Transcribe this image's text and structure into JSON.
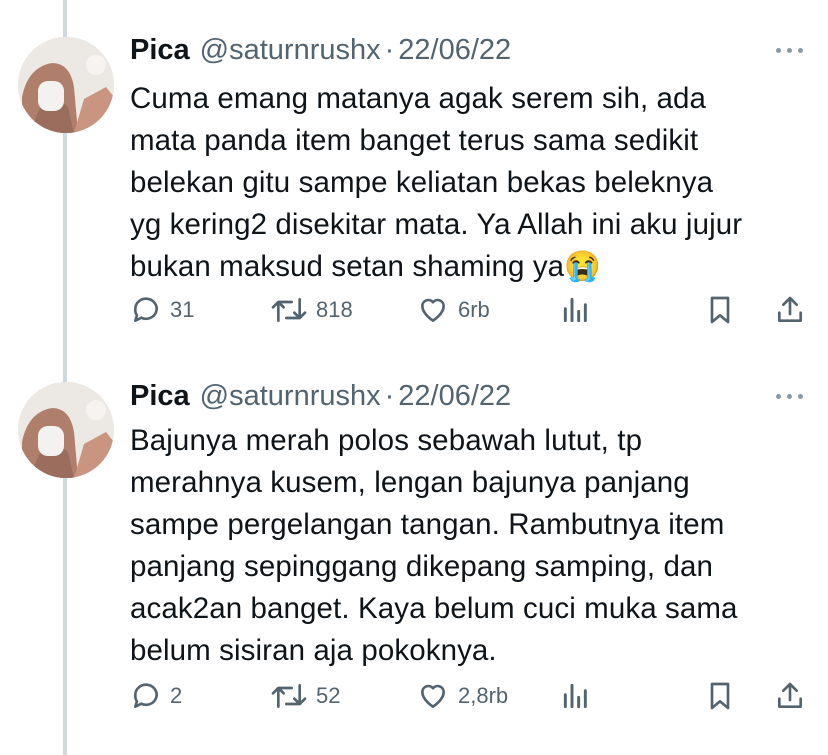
{
  "colors": {
    "text": "#0f1419",
    "muted": "#536471",
    "thread_line": "#cfd9de"
  },
  "tweets": [
    {
      "name": "Pica",
      "handle": "@saturnrushx",
      "separator": "·",
      "date": "22/06/22",
      "text": "Cuma emang matanya agak serem sih, ada mata panda item banget terus sama sedikit belekan gitu sampe keliatan bekas beleknya yg kering2 disekitar mata. Ya Allah ini aku jujur bukan maksud setan shaming ya😭",
      "lines": [
        "Cuma emang matanya agak serem sih, ada",
        "mata panda item banget terus sama sedikit",
        "belekan gitu sampe keliatan bekas beleknya",
        "yg kering2 disekitar mata. Ya Allah ini aku jujur",
        "bukan maksud setan shaming ya😭"
      ],
      "replies": "31",
      "retweets": "818",
      "likes": "6rb",
      "icons": [
        "reply-icon",
        "retweet-icon",
        "like-icon",
        "views-icon",
        "bookmark-icon",
        "share-icon"
      ]
    },
    {
      "name": "Pica",
      "handle": "@saturnrushx",
      "separator": "·",
      "date": "22/06/22",
      "text": "Bajunya merah polos sebawah lutut, tp merahnya kusem, lengan bajunya panjang sampe pergelangan tangan. Rambutnya item panjang sepinggang dikepang samping, dan acak2an banget. Kaya belum cuci muka sama belum sisiran aja pokoknya.",
      "lines": [
        "Bajunya merah polos sebawah lutut, tp",
        "merahnya kusem, lengan bajunya panjang",
        "sampe pergelangan tangan. Rambutnya item",
        "panjang sepinggang dikepang samping, dan",
        "acak2an banget. Kaya belum cuci muka sama",
        "belum sisiran aja pokoknya."
      ],
      "replies": "2",
      "retweets": "52",
      "likes": "2,8rb",
      "icons": [
        "reply-icon",
        "retweet-icon",
        "like-icon",
        "views-icon",
        "bookmark-icon",
        "share-icon"
      ]
    }
  ]
}
